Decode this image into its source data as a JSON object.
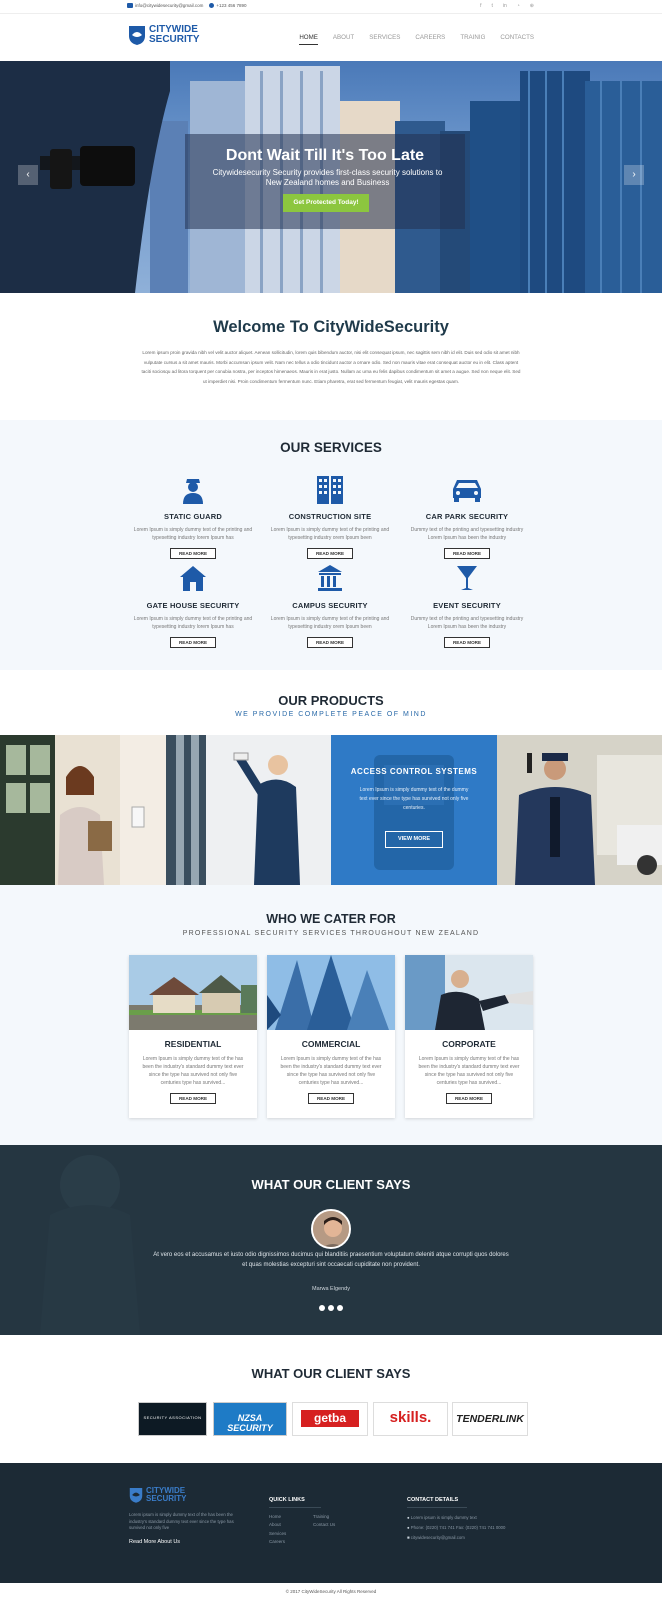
{
  "topbar": {
    "email": "info@citywidesecurity@gmail.com",
    "phone": "+123 456 7890",
    "social_icons": [
      "facebook-icon",
      "twitter-icon",
      "linkedin-icon",
      "rss-icon",
      "globe-icon"
    ]
  },
  "header": {
    "logo_line1": "CITYWIDE",
    "logo_line2": "SECURITY",
    "nav": [
      "HOME",
      "ABOUT",
      "SERVICES",
      "CAREERS",
      "TRAINIG",
      "CONTACTS"
    ],
    "active": "HOME"
  },
  "hero": {
    "title": "Dont Wait Till It's Too Late",
    "subtitle": "Citywidesecurity Security provides first-class security solutions to New Zealand homes and Business",
    "cta": "Get Protected Today!",
    "prev": "‹",
    "next": "›"
  },
  "welcome": {
    "title": "Welcome To CityWideSecurity",
    "body": "Lorem ipsum proin gravida nibh vel velit auctor aliquet. Aenean sollicitudin, lorem quis bibendum auctor, nisi elit consequat ipsum, nec sagittis sem nibh id elit. Duis sed odio sit amet nibh vulputate cursus a sit amet mauris. Morbi accumsan ipsum velit. Nam nec tellus a odio tincidunt auctor a ornare odio. Sed non mauris vitae erat consequat auctor eu in elit. Class aptent taciti sociosqu ad litora torquent per conubia nostra, per inceptos himenaeos. Mauris in erat justo. Nullam ac urna eu felis dapibus condimentum sit amet a augue. Sed non neque elit. Sed ut imperdiet nisi. Proin condimentum fermentum nunc. Etiam pharetra, erat sed fermentum feugiat, velit mauris egestas quam."
  },
  "services": {
    "title": "OUR SERVICES",
    "read_more": "READ MORE",
    "items": [
      {
        "title": "STATIC GUARD",
        "text": "Lorem Ipsum is simply dummy text of the printing and typesetting industry lorem Ipsum has",
        "icon": "guard-icon"
      },
      {
        "title": "CONSTRUCTION SITE",
        "text": "Lorem Ipsum is simply dummy text of the printing and typesetting industry orem Ipsum been",
        "icon": "building-icon"
      },
      {
        "title": "CAR PARK SECURITY",
        "text": "Dummy text of the printing and typesetting industry Lorem Ipsum has been the industry",
        "icon": "car-icon"
      },
      {
        "title": "GATE HOUSE SECURITY",
        "text": "Lorem Ipsum is simply dummy text of the printing and typesetting industry lorem Ipsum has",
        "icon": "house-icon"
      },
      {
        "title": "CAMPUS SECURITY",
        "text": "Lorem Ipsum is simply dummy text of the printing and typesetting industry orem Ipsum been",
        "icon": "campus-icon"
      },
      {
        "title": "EVENT SECURITY",
        "text": "Dummy text of the printing and typesetting industry Lorem Ipsum has been the industry",
        "icon": "cocktail-icon"
      }
    ]
  },
  "products": {
    "title": "OUR PRODUCTS",
    "subtitle": "WE PROVIDE COMPLETE PEACE OF MIND",
    "feature_title": "ACCESS CONTROL SYSTEMS",
    "feature_text": "Lorem Ipsum is simply dummy text of the dummy text ever since the type has survived not only five centuries.",
    "feature_button": "VIEW MORE"
  },
  "cater": {
    "title": "WHO WE CATER FOR",
    "subtitle": "PROFESSIONAL SECURITY SERVICES THROUGHOUT NEW ZEALAND",
    "read_more": "READ MORE",
    "cards": [
      {
        "title": "RESIDENTIAL",
        "text": "Lorem Ipsum is simply dummy text of the has been the industry's standard dummy text ever since the type has survived not only five centuries type has survived..."
      },
      {
        "title": "COMMERCIAL",
        "text": "Lorem Ipsum is simply dummy text of the has been the industry's standard dummy text ever since the type has survived not only five centuries type has survived..."
      },
      {
        "title": "CORPORATE",
        "text": "Lorem Ipsum is simply dummy text of the has been the industry's standard dummy text ever since the type has survived not only five centuries type has survived..."
      }
    ]
  },
  "testimonial": {
    "title": "WHAT OUR CLIENT SAYS",
    "quote": "At vero eos et accusamus et iusto odio dignissimos ducimus qui blanditiis praesentium voluptatum deleniti atque corrupti quos dolores et quas molestias excepturi sint occaecati cupiditate non provident.",
    "name": "Marwa Elgendy"
  },
  "partners": {
    "title": "WHAT OUR CLIENT SAYS",
    "logos": [
      {
        "name": "SECURITY ASSOCIATION",
        "bg": "#0d1a24",
        "fg": "#ffffff"
      },
      {
        "name": "NZSA SECURITY",
        "bg": "#1e7bc6",
        "fg": "#ffffff"
      },
      {
        "name": "getba",
        "bg": "#ffffff",
        "fg": "#d62020"
      },
      {
        "name": "skills.",
        "bg": "#ffffff",
        "fg": "#d62020"
      },
      {
        "name": "TENDERLINK",
        "bg": "#ffffff",
        "fg": "#222222"
      }
    ]
  },
  "footer": {
    "about_text": "Lorem ipsum is simply dummy text of the has been the industry's standard dummy text ever since the type has survived not only five",
    "about_link": "Read More About Us",
    "quick_title": "QUICK LINKS",
    "quick_col1": [
      "Home",
      "About",
      "Services",
      "Careers"
    ],
    "quick_col2": [
      "Training",
      "Contact Us"
    ],
    "contact_title": "CONTACT DETAILS",
    "contact": [
      "Lorem ipsum is simply dummy text",
      "Phone: (0220) 741 741 Fax: (0220) 741 741 0000",
      "citywidesecurity@gmail.com"
    ],
    "copyright": "© 2017 CityWideSecurity All Rights Reserved"
  },
  "colors": {
    "brand": "#1e5aa8",
    "cta": "#8cc63f",
    "dark": "#1f2a35"
  }
}
